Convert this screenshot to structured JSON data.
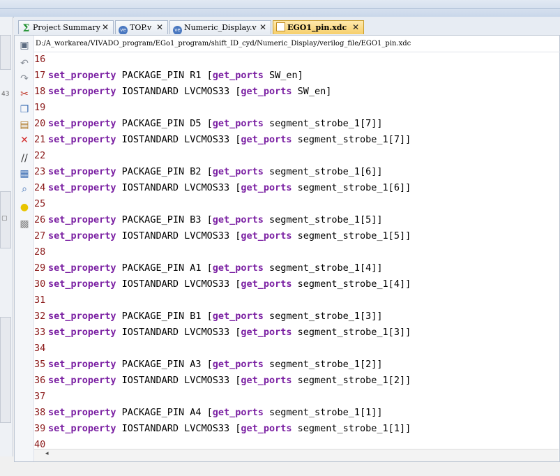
{
  "tabs": [
    {
      "label": "Project Summary",
      "icon": "sigma-icon",
      "active": false
    },
    {
      "label": "TOP.v",
      "icon": "verilog-file-icon",
      "active": false
    },
    {
      "label": "Numeric_Display.v",
      "icon": "verilog-file-icon",
      "active": false
    },
    {
      "label": "EGO1_pin.xdc",
      "icon": "xdc-file-icon",
      "active": true
    }
  ],
  "close_glyph": "✕",
  "file_path": "D:/A_workarea/VIVADO_program/EGo1_program/shift_ID_cyd/Numeric_Display/verilog_file/EGO1_pin.xdc",
  "lines": [
    {
      "num": "16",
      "kw1": "",
      "mid": "",
      "kw2": "",
      "tail": ""
    },
    {
      "num": "17",
      "kw1": "set_property",
      "mid": " PACKAGE_PIN R1 [",
      "kw2": "get_ports",
      "tail": " SW_en]"
    },
    {
      "num": "18",
      "kw1": "set_property",
      "mid": " IOSTANDARD LVCMOS33 [",
      "kw2": "get_ports",
      "tail": " SW_en]"
    },
    {
      "num": "19",
      "kw1": "",
      "mid": "",
      "kw2": "",
      "tail": ""
    },
    {
      "num": "20",
      "kw1": "set_property",
      "mid": " PACKAGE_PIN D5 [",
      "kw2": "get_ports",
      "tail": " segment_strobe_1[7]]"
    },
    {
      "num": "21",
      "kw1": "set_property",
      "mid": " IOSTANDARD LVCMOS33 [",
      "kw2": "get_ports",
      "tail": " segment_strobe_1[7]]"
    },
    {
      "num": "22",
      "kw1": "",
      "mid": "",
      "kw2": "",
      "tail": ""
    },
    {
      "num": "23",
      "kw1": "set_property",
      "mid": " PACKAGE_PIN B2 [",
      "kw2": "get_ports",
      "tail": " segment_strobe_1[6]]"
    },
    {
      "num": "24",
      "kw1": "set_property",
      "mid": " IOSTANDARD LVCMOS33 [",
      "kw2": "get_ports",
      "tail": " segment_strobe_1[6]]"
    },
    {
      "num": "25",
      "kw1": "",
      "mid": "",
      "kw2": "",
      "tail": ""
    },
    {
      "num": "26",
      "kw1": "set_property",
      "mid": " PACKAGE_PIN B3 [",
      "kw2": "get_ports",
      "tail": " segment_strobe_1[5]]"
    },
    {
      "num": "27",
      "kw1": "set_property",
      "mid": " IOSTANDARD LVCMOS33 [",
      "kw2": "get_ports",
      "tail": " segment_strobe_1[5]]"
    },
    {
      "num": "28",
      "kw1": "",
      "mid": "",
      "kw2": "",
      "tail": ""
    },
    {
      "num": "29",
      "kw1": "set_property",
      "mid": " PACKAGE_PIN A1 [",
      "kw2": "get_ports",
      "tail": " segment_strobe_1[4]]"
    },
    {
      "num": "30",
      "kw1": "set_property",
      "mid": " IOSTANDARD LVCMOS33 [",
      "kw2": "get_ports",
      "tail": " segment_strobe_1[4]]"
    },
    {
      "num": "31",
      "kw1": "",
      "mid": "",
      "kw2": "",
      "tail": ""
    },
    {
      "num": "32",
      "kw1": "set_property",
      "mid": " PACKAGE_PIN B1 [",
      "kw2": "get_ports",
      "tail": " segment_strobe_1[3]]"
    },
    {
      "num": "33",
      "kw1": "set_property",
      "mid": " IOSTANDARD LVCMOS33 [",
      "kw2": "get_ports",
      "tail": " segment_strobe_1[3]]"
    },
    {
      "num": "34",
      "kw1": "",
      "mid": "",
      "kw2": "",
      "tail": ""
    },
    {
      "num": "35",
      "kw1": "set_property",
      "mid": " PACKAGE_PIN A3 [",
      "kw2": "get_ports",
      "tail": " segment_strobe_1[2]]"
    },
    {
      "num": "36",
      "kw1": "set_property",
      "mid": " IOSTANDARD LVCMOS33 [",
      "kw2": "get_ports",
      "tail": " segment_strobe_1[2]]"
    },
    {
      "num": "37",
      "kw1": "",
      "mid": "",
      "kw2": "",
      "tail": ""
    },
    {
      "num": "38",
      "kw1": "set_property",
      "mid": " PACKAGE_PIN A4 [",
      "kw2": "get_ports",
      "tail": " segment_strobe_1[1]]"
    },
    {
      "num": "39",
      "kw1": "set_property",
      "mid": " IOSTANDARD LVCMOS33 [",
      "kw2": "get_ports",
      "tail": " segment_strobe_1[1]]"
    },
    {
      "num": "40",
      "kw1": "",
      "mid": "",
      "kw2": "",
      "tail": ""
    }
  ],
  "toolbar_icons": [
    "save-icon",
    "undo-icon",
    "redo-icon",
    "cut-icon",
    "copy-icon",
    "paste-icon",
    "delete-icon",
    "comment-icon",
    "select-all-icon",
    "find-replace-icon",
    "lightbulb-icon",
    "template-icon"
  ],
  "colors": {
    "keyword": "#7a1fa2",
    "line_number": "#8b1a1a",
    "active_tab": "#f6cf6b"
  },
  "scroll_left_glyph": "◂"
}
